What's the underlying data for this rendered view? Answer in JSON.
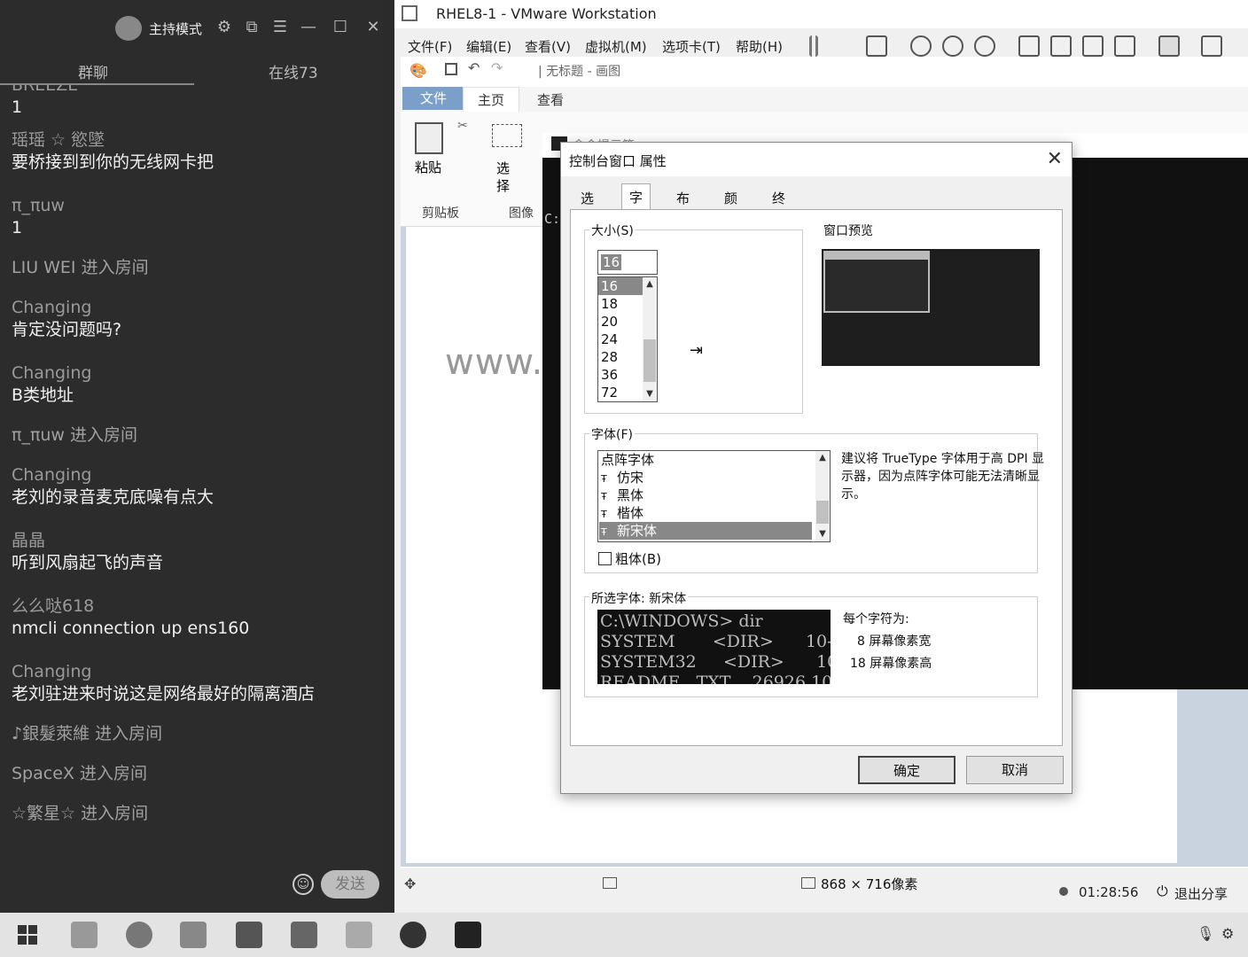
{
  "chat": {
    "host_label": "主持模式",
    "tabs": [
      "群聊",
      "在线73"
    ],
    "messages": [
      {
        "nick": "BREEZE",
        "text": "1"
      },
      {
        "nick": "瑶瑶 ☆ 慾墜",
        "text": "要桥接到到你的无线网卡把"
      },
      {
        "nick": "π_πuw",
        "text": "1"
      },
      {
        "nick": "LIU WEI 进入房间",
        "text": ""
      },
      {
        "nick": "Changing",
        "text": "肯定没问题吗?"
      },
      {
        "nick": "Changing",
        "text": "B类地址"
      },
      {
        "nick": "π_πuw 进入房间",
        "text": ""
      },
      {
        "nick": "Changing",
        "text": "老刘的录音麦克底噪有点大"
      },
      {
        "nick": "晶晶",
        "text": "听到风扇起飞的声音"
      },
      {
        "nick": "么么哒618",
        "text": "nmcli connection up ens160"
      },
      {
        "nick": "Changing",
        "text": "老刘驻进来时说这是网络最好的隔离酒店"
      },
      {
        "nick": "♪銀髮萊維 进入房间",
        "text": ""
      },
      {
        "nick": "SpaceX 进入房间",
        "text": ""
      },
      {
        "nick": "☆繁星☆ 进入房间",
        "text": ""
      }
    ],
    "send_label": "发送"
  },
  "vmware": {
    "title": "RHEL8-1 - VMware Workstation",
    "menu": [
      "文件(F)",
      "编辑(E)",
      "查看(V)",
      "虚拟机(M)",
      "选项卡(T)",
      "帮助(H)"
    ]
  },
  "paint": {
    "doc_title": "| 无标题 - 画图",
    "tabs": [
      "文件",
      "主页",
      "查看"
    ],
    "groups": [
      "剪贴板",
      "图像"
    ],
    "paste_label": "粘贴",
    "select_label": "选\n择",
    "canvas_text": "www.",
    "size_readout": "868 × 716像素"
  },
  "cmd": {
    "title": "命令提示符",
    "prompt": "C:"
  },
  "dialog": {
    "title": "控制台窗口 属性",
    "tabs": [
      "选项",
      "字体",
      "布局",
      "颜色",
      "终端"
    ],
    "active_tab": "字体",
    "size_group": "大小(S)",
    "size_value": "16",
    "sizes": [
      "16",
      "18",
      "20",
      "24",
      "28",
      "36",
      "72"
    ],
    "preview_group": "窗口预览",
    "font_group": "字体(F)",
    "fonts": [
      "点阵字体",
      "仿宋",
      "黑体",
      "楷体",
      "新宋体"
    ],
    "selected_font": "新宋体",
    "truetype_note": "建议将 TrueType 字体用于高 DPI 显示器，因为点阵字体可能无法清晰显示。",
    "bold_label": "粗体(B)",
    "selected_font_label": "所选字体: 新宋体",
    "sample_lines": [
      "C:\\WINDOWS> dir",
      "SYSTEM       <DIR>      10-",
      "SYSTEM32     <DIR>      10-",
      "README   TXT    26926 10-"
    ],
    "char_info_title": "每个字符为:",
    "char_width": "8 屏幕像素宽",
    "char_height": "18 屏幕像素高",
    "ok_label": "确定",
    "cancel_label": "取消"
  },
  "meeting": {
    "timer": "01:28:56",
    "exit_share": "退出分享"
  }
}
